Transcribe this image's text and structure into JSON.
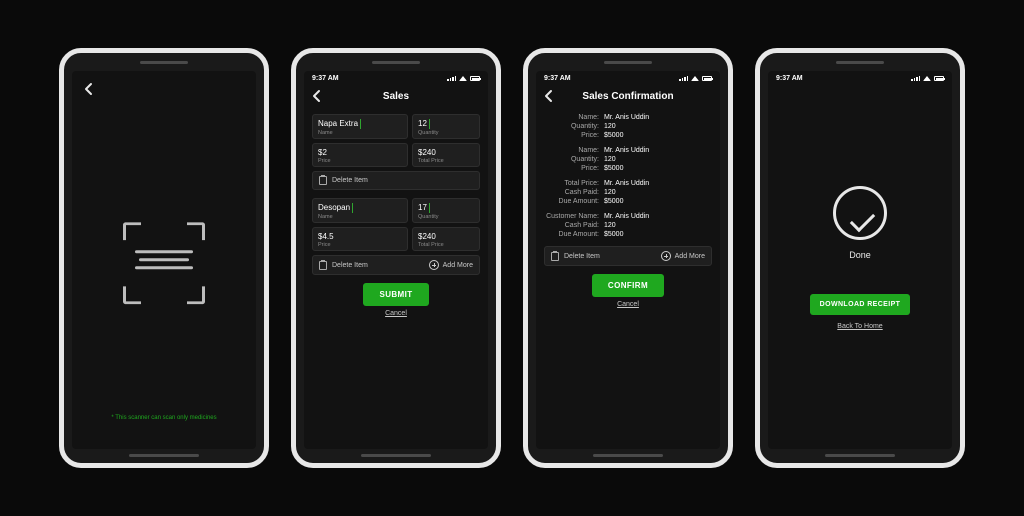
{
  "status_time": "9:37 AM",
  "screen1": {
    "scan_note": "* This scanner can scan only medicines"
  },
  "screen2": {
    "title": "Sales",
    "item1": {
      "name": "Napa Extra",
      "qty": "12",
      "price": "$2",
      "total": "$240"
    },
    "item2": {
      "name": "Desopan",
      "qty": "17",
      "price": "$4.5",
      "total": "$240"
    },
    "labels": {
      "name": "Name",
      "qty": "Quantity",
      "price": "Price",
      "total": "Total Price"
    },
    "delete": "Delete Item",
    "add_more": "Add More",
    "submit": "SUBMIT",
    "cancel": "Cancel"
  },
  "screen3": {
    "title": "Sales Confirmation",
    "g1": {
      "name_l": "Name:",
      "name": "Mr. Anis Uddin",
      "qty_l": "Quantity:",
      "qty": "120",
      "price_l": "Price:",
      "price": "$5000"
    },
    "g2": {
      "name_l": "Name:",
      "name": "Mr. Anis Uddin",
      "qty_l": "Quantity:",
      "qty": "120",
      "price_l": "Price:",
      "price": "$5000"
    },
    "g3": {
      "tp_l": "Total Price:",
      "tp": "Mr. Anis Uddin",
      "cp_l": "Cash Paid:",
      "cp": "120",
      "da_l": "Due Amount:",
      "da": "$5000"
    },
    "g4": {
      "cn_l": "Customer Name:",
      "cn": "Mr. Anis Uddin",
      "cp_l": "Cash Paid:",
      "cp": "120",
      "da_l": "Due Amount:",
      "da": "$5000"
    },
    "delete": "Delete Item",
    "add_more": "Add More",
    "confirm": "CONFIRM",
    "cancel": "Cancel"
  },
  "screen4": {
    "done": "Done",
    "download": "DOWNLOAD RECEIPT",
    "back_home": "Back To Home"
  }
}
